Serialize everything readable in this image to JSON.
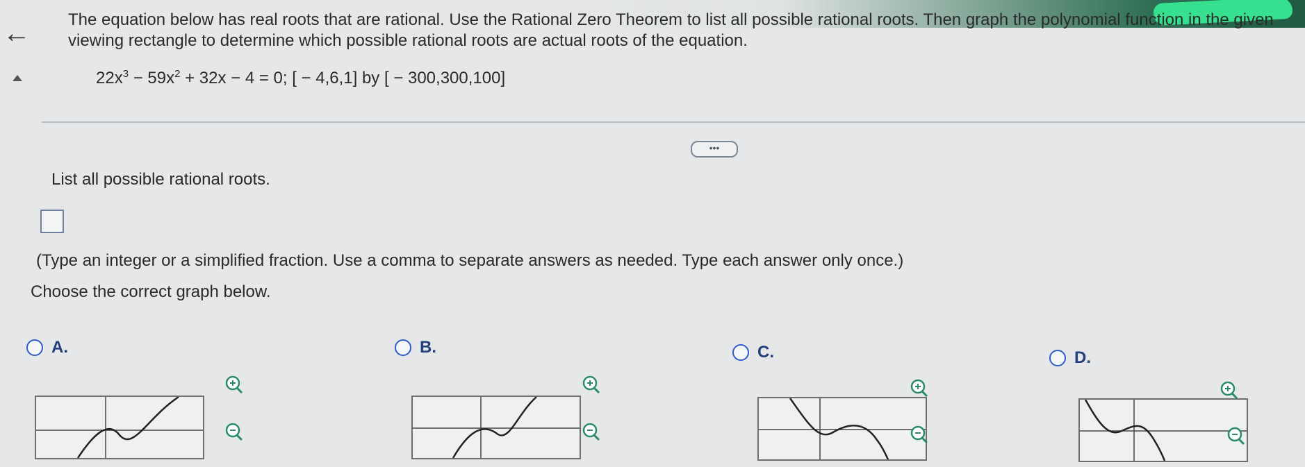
{
  "problem": {
    "instructions_line1": "The equation below has real roots that are rational. Use the Rational Zero Theorem to list all possible rational roots. Then graph the polynomial function in the given",
    "instructions_line2": "viewing rectangle to determine which possible rational roots are actual roots of the equation.",
    "equation": {
      "t1": "22x",
      "e1": "3",
      "t2": " − 59x",
      "e2": "2",
      "t3": " + 32x − 4 = 0; [ − 4,6,1] by [ − 300,300,100]"
    },
    "more_label": "•••"
  },
  "part1": {
    "prompt": "List all possible rational roots.",
    "answer_value": "",
    "hint": "(Type an integer or a simplified fraction. Use a comma to separate answers as needed. Type each answer only once.)"
  },
  "part2": {
    "prompt": "Choose the correct graph below.",
    "options": [
      {
        "label": "A."
      },
      {
        "label": "B."
      },
      {
        "label": "C."
      },
      {
        "label": "D."
      }
    ]
  },
  "colors": {
    "option_label": "#23407a",
    "radio_border": "#2f5cc8",
    "zoom_border": "#2a8a6a",
    "graph_line": "#222222"
  },
  "icons": [
    "back-arrow-icon",
    "collapse-caret-icon",
    "zoom-in-icon",
    "zoom-out-icon"
  ]
}
